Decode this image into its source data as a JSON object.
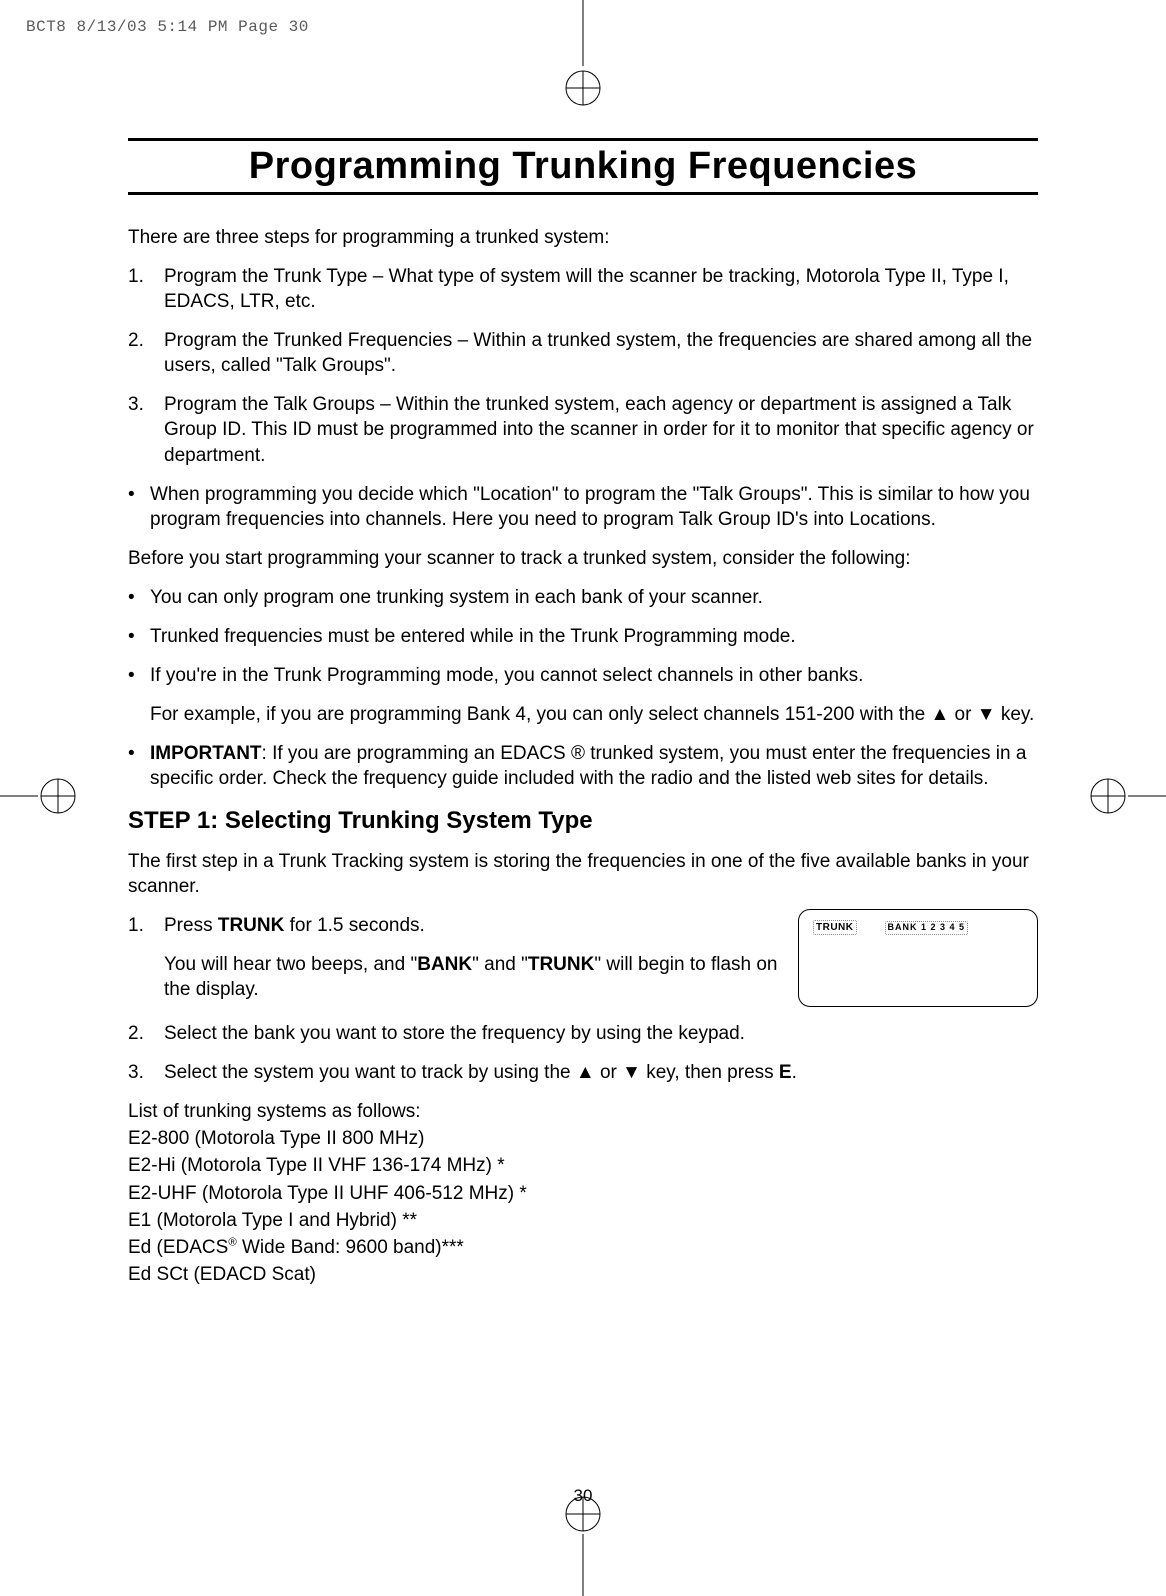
{
  "meta": {
    "header": "BCT8  8/13/03 5:14 PM  Page 30"
  },
  "title": "Programming Trunking Frequencies",
  "intro": "There are three steps for programming a trunked system:",
  "steps_overview": {
    "1": "Program the Trunk Type – What type of system will the scanner be tracking, Motorola Type II, Type I, EDACS, LTR, etc.",
    "2": "Program the Trunked Frequencies – Within a trunked system, the frequencies are shared among all the users, called \"Talk Groups\".",
    "3": "Program the Talk Groups – Within the trunked system, each agency or department is assigned a Talk Group ID. This ID must be programmed into the scanner in order for it to monitor that specific agency or department."
  },
  "bullets_intro": {
    "b1": "When programming you decide which \"Location\" to program the \"Talk Groups\". This is similar to how you program frequencies into channels. Here you need to program Talk Group ID's into Locations."
  },
  "before": "Before you start programming your scanner to track a trunked system, consider the following:",
  "considerations": {
    "c1": "You can only program one trunking system in each bank of your scanner.",
    "c2": "Trunked frequencies must be entered while in the Trunk Programming mode.",
    "c3": "If you're in the Trunk Programming mode, you cannot select channels in other banks.",
    "c3_example": "For example, if you are programming Bank 4, you can only select channels 151-200 with the ▲ or ▼ key.",
    "c4_label": "IMPORTANT",
    "c4_rest": ": If you are programming an EDACS ® trunked system, you must enter the frequencies in a specific order. Check the frequency guide included with the radio and the listed web sites for details."
  },
  "step1": {
    "heading": "STEP 1: Selecting Trunking System Type",
    "p1": "The first step in a Trunk Tracking system is storing the frequencies in one of the five available banks in your scanner.",
    "i1_pre": "Press ",
    "i1_bold": "TRUNK",
    "i1_post": " for 1.5 seconds.",
    "i1_sub_pre": "You will hear two beeps, and \"",
    "i1_sub_b1": "BANK",
    "i1_sub_mid": "\" and \"",
    "i1_sub_b2": "TRUNK",
    "i1_sub_post": "\" will begin to flash on the display.",
    "i2": "Select the bank you want to store the frequency by using the keypad.",
    "i3_pre": "Select the system you want to track by using the ▲ or ▼ key, then press ",
    "i3_bold": "E",
    "i3_post": "."
  },
  "display": {
    "trunk": "TRUNK",
    "bank": "BANK 1 2 3 4 5"
  },
  "syslist": {
    "hdr": "List of trunking systems as follows:",
    "l1": "E2-800 (Motorola Type II 800 MHz)",
    "l2": "E2-Hi (Motorola Type II VHF 136-174 MHz) *",
    "l3": "E2-UHF (Motorola Type II UHF 406-512 MHz) *",
    "l4": "E1 (Motorola Type I and Hybrid) **",
    "l5_pre": "Ed (EDACS",
    "l5_post": " Wide Band: 9600 band)***",
    "l6": "Ed SCt (EDACD Scat)"
  },
  "pagenum": "30"
}
